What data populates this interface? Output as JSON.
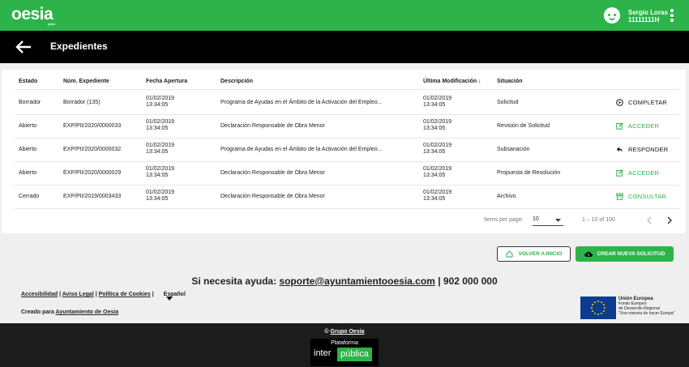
{
  "app": {
    "logo": "oesia",
    "logo_small": "gestión",
    "user_name": "Sergio Loras",
    "user_id": "11111111H",
    "accent": "#2db34a"
  },
  "page": {
    "title": "Expedientes"
  },
  "table": {
    "headers": [
      "Estado",
      "Núm. Expediente",
      "Fecha Apertura",
      "Descripción",
      "Última Modificación ↓",
      "Situación"
    ],
    "rows": [
      {
        "estado": "Borrador",
        "num": "Borrador (135)",
        "fa1": "01/02/2019",
        "fa2": "13:34:05",
        "desc": "Programa de Ayudas en el Ámbito de la Activación del Empleo...",
        "um1": "01/02/2019",
        "um2": "13:34:05",
        "sit": "Solicitud",
        "action": "COMPLETAR",
        "icon": "play-circle-icon",
        "green": false
      },
      {
        "estado": "Abierto",
        "num": "EXP/PII/2020/0000033",
        "fa1": "01/02/2019",
        "fa2": "13:34:05",
        "desc": "Declaración Responsable de Obra Menor",
        "um1": "01/02/2019",
        "um2": "13:34:05",
        "sit": "Revisión de Solicitud",
        "action": "ACCEDER",
        "icon": "edit-icon",
        "green": true
      },
      {
        "estado": "Abierto",
        "num": "EXP/PII/2020/0000032",
        "fa1": "01/02/2019",
        "fa2": "13:34:05",
        "desc": "Programa de Ayudas en el Ámbito de la Activación del Empleo...",
        "um1": "01/02/2019",
        "um2": "13:34:05",
        "sit": "Subsanación",
        "action": "RESPONDER",
        "icon": "reply-icon",
        "green": false
      },
      {
        "estado": "Abierto",
        "num": "EXP/PII/2020/0000029",
        "fa1": "01/02/2019",
        "fa2": "13:34:05",
        "desc": "Declaración Responsable de Obra Menor",
        "um1": "01/02/2019",
        "um2": "13:34:05",
        "sit": "Propuesta de Resolución",
        "action": "ACCEDER",
        "icon": "edit-icon",
        "green": true
      },
      {
        "estado": "Cerrado",
        "num": "EXP/PII/2019/0003433",
        "fa1": "01/02/2019",
        "fa2": "13:34:05",
        "desc": "Declaración Responsable de Obra Menor",
        "um1": "01/02/2019",
        "um2": "13:34:05",
        "sit": "Archivo",
        "action": "CONSULTAR",
        "icon": "archive-icon",
        "green": true
      }
    ]
  },
  "pagination": {
    "items_label": "Items per page:",
    "items_value": "10",
    "range": "1 – 10 of 100"
  },
  "buttons": {
    "home": "VOLVER A INICIO",
    "new": "CREAR NUEVA SOLICITUD"
  },
  "help": {
    "prefix": "Si necesita ayuda:",
    "email": "soporte@ayuntamientooesia.com",
    "sep": "|",
    "phone": "902 000 000"
  },
  "footer_links": {
    "a": "Accesibilidad",
    "b": "Aviso Legal",
    "c": "Política de Cookies",
    "lang": "Español",
    "created_prefix": "Creado para",
    "created_link": "Ayuntamiento de Oesia"
  },
  "eu": {
    "t1": "Unión Europea",
    "t2": "Fondo Europeo",
    "t3": "de Desarrollo Regional",
    "t4": "\"Una manera de hacer Europa\""
  },
  "bottom": {
    "copy_symbol": "©",
    "copy_link": "Grupo Oesia",
    "plat1": "Plataforma",
    "plat2": "inter",
    "plat3": "pública"
  }
}
